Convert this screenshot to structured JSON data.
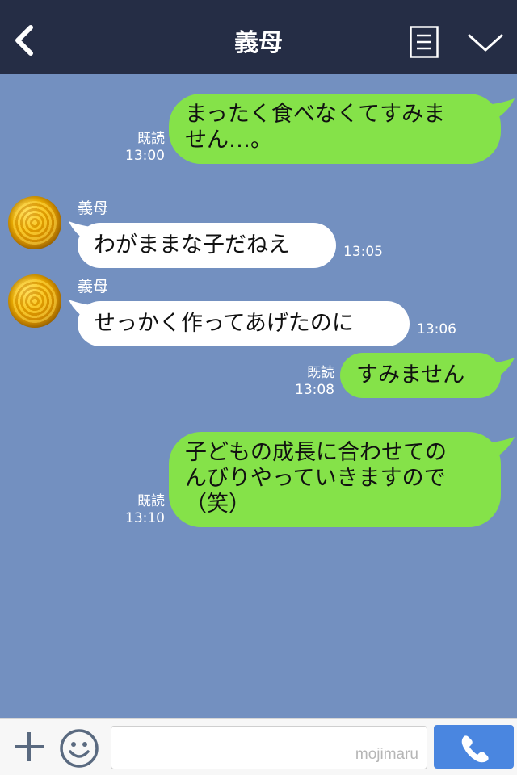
{
  "header": {
    "title": "義母"
  },
  "messages": [
    {
      "side": "out",
      "text_lines": [
        "まったく食べなくてすみま",
        "せん…。"
      ],
      "read": "既読",
      "time": "13:00"
    },
    {
      "side": "in",
      "sender": "義母",
      "text": "わがままな子だねえ",
      "time": "13:05"
    },
    {
      "side": "in",
      "sender": "義母",
      "text": "せっかく作ってあげたのに",
      "time": "13:06"
    },
    {
      "side": "out",
      "text": "すみません",
      "read": "既読",
      "time": "13:08"
    },
    {
      "side": "out",
      "text_lines": [
        "子どもの成長に合わせての",
        "んびりやっていきますので",
        "（笑）"
      ],
      "read": "既読",
      "time": "13:10"
    }
  ],
  "footer": {
    "watermark": "mojimaru"
  },
  "colors": {
    "header_bg": "#252d45",
    "chat_bg": "#7390c0",
    "outgoing_bubble": "#85e249",
    "incoming_bubble": "#ffffff",
    "call_button": "#4a86e0"
  },
  "icons": [
    "back-arrow-icon",
    "menu-list-icon",
    "chevron-down-icon",
    "plus-icon",
    "smiley-icon",
    "phone-icon"
  ]
}
